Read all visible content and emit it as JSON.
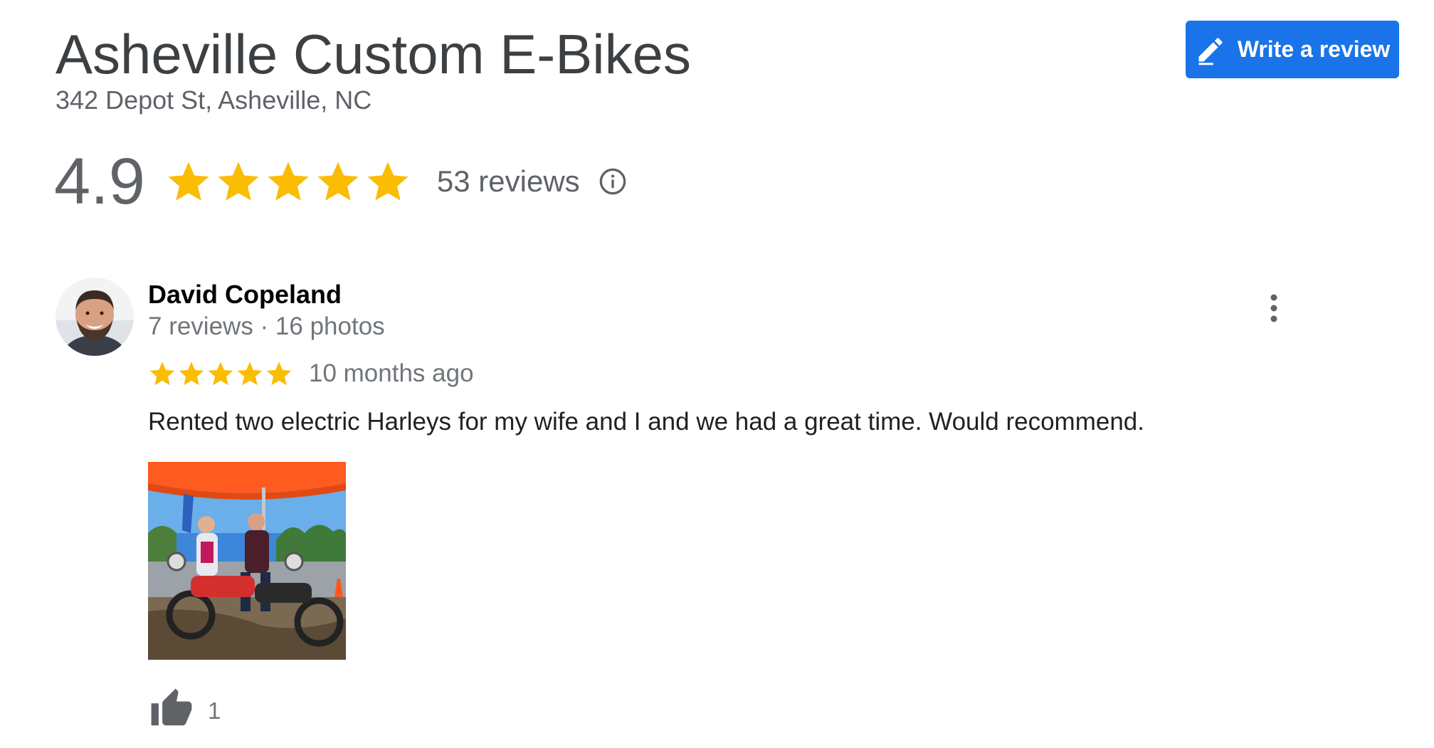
{
  "business": {
    "name": "Asheville Custom E-Bikes",
    "address": "342 Depot St, Asheville, NC"
  },
  "write_review_button": {
    "label": "Write a review",
    "icon": "pencil-icon",
    "color": "#1a73e8"
  },
  "rating_summary": {
    "value": "4.9",
    "stars": 5,
    "review_count": "53 reviews",
    "info_icon": "info-icon",
    "star_color": "#fbbc04"
  },
  "review": {
    "reviewer_name": "David Copeland",
    "reviewer_meta": "7 reviews · 16 photos",
    "rating": 5,
    "date": "10 months ago",
    "text": "Rented two electric Harleys for my wife and I and we had a great time. Would recommend.",
    "avatar_icon": "reviewer-avatar",
    "photo": "review-photo",
    "like_icon": "thumbs-up-icon",
    "like_count": "1",
    "menu_icon": "more-vert-icon"
  }
}
